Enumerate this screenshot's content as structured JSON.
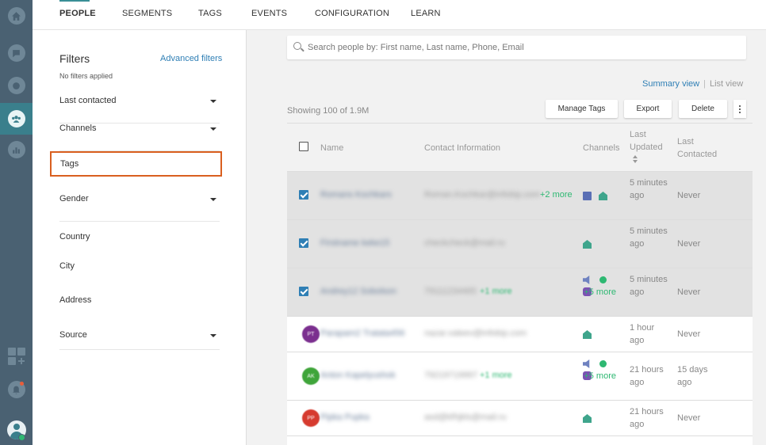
{
  "topnav": {
    "tabs": [
      "PEOPLE",
      "SEGMENTS",
      "TAGS",
      "EVENTS",
      "CONFIGURATION",
      "LEARN"
    ]
  },
  "filters": {
    "title": "Filters",
    "advanced_label": "Advanced filters",
    "status": "No filters applied",
    "items": {
      "last_contacted": "Last contacted",
      "channels": "Channels",
      "tags": "Tags",
      "gender": "Gender",
      "country": "Country",
      "city": "City",
      "address": "Address",
      "source": "Source"
    }
  },
  "search": {
    "placeholder": "Search people by: First name, Last name, Phone, Email"
  },
  "view": {
    "summary": "Summary view",
    "list": "List view"
  },
  "toolbar": {
    "showing": "Showing 100 of 1.9M",
    "manage_tags": "Manage Tags",
    "export": "Export",
    "delete": "Delete"
  },
  "table": {
    "headers": {
      "name": "Name",
      "contact": "Contact Information",
      "channels": "Channels",
      "last_updated": "Last Updated",
      "last_contacted": "Last Contacted"
    },
    "rows": [
      {
        "name": "Romans Kochkars",
        "contact": "Roman.Kochkar@infobip.com",
        "more": "+2 more",
        "updated": "5 minutes ago",
        "contacted": "Never",
        "channels_more": ""
      },
      {
        "name": "Firstname keke15",
        "contact": "checkcheck@mail.ru",
        "more": "",
        "updated": "5 minutes ago",
        "contacted": "Never",
        "channels_more": ""
      },
      {
        "name": "Andrey12 Sobolson",
        "contact": "79111234465",
        "more": "+1 more",
        "updated": "5 minutes ago",
        "contacted": "Never",
        "channels_more": "+5 more"
      },
      {
        "name": "Parapam2 Tratata456",
        "initials": "PT",
        "contact": "nazar.valeev@infobip.com",
        "more": "",
        "updated": "1 hour ago",
        "contacted": "Never",
        "channels_more": ""
      },
      {
        "name": "Anton Kapelyushok",
        "initials": "AK",
        "contact": "79219719997",
        "more": "+1 more",
        "updated": "21 hours ago",
        "contacted": "15 days ago",
        "channels_more": "+5 more"
      },
      {
        "name": "Pipka Pupka",
        "initials": "PP",
        "contact": "asd@kfhjkls@mail.ru",
        "more": "",
        "updated": "21 hours ago",
        "contacted": "Never",
        "channels_more": ""
      }
    ]
  },
  "colors": {
    "rail": "#4a6172",
    "rail_active": "#3a7f8c",
    "accent_link": "#2f7fb5",
    "highlight_border": "#d95f1f",
    "avatar_pt": "#7b2f8f",
    "avatar_ak": "#3fa53a",
    "avatar_pp": "#d63b2f"
  },
  "icons": [
    "home-icon",
    "chat-icon",
    "conversation-icon",
    "people-icon",
    "analytics-icon",
    "apps-add-icon",
    "bell-icon",
    "account-avatar-icon"
  ]
}
